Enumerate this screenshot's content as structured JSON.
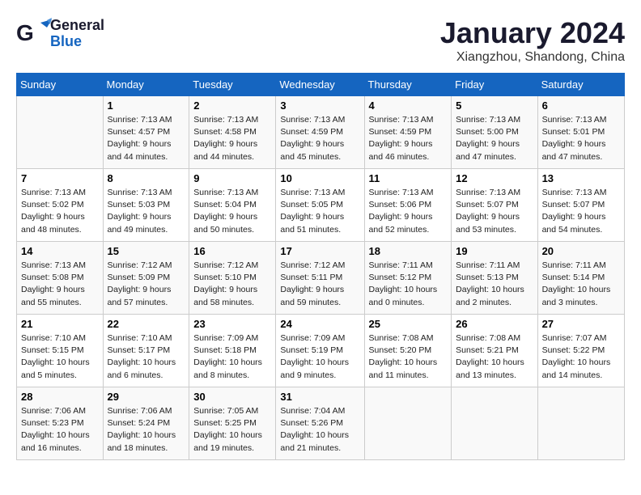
{
  "header": {
    "logo_general": "General",
    "logo_blue": "Blue",
    "month_year": "January 2024",
    "location": "Xiangzhou, Shandong, China"
  },
  "weekdays": [
    "Sunday",
    "Monday",
    "Tuesday",
    "Wednesday",
    "Thursday",
    "Friday",
    "Saturday"
  ],
  "weeks": [
    [
      {
        "day": "",
        "text": ""
      },
      {
        "day": "1",
        "text": "Sunrise: 7:13 AM\nSunset: 4:57 PM\nDaylight: 9 hours\nand 44 minutes."
      },
      {
        "day": "2",
        "text": "Sunrise: 7:13 AM\nSunset: 4:58 PM\nDaylight: 9 hours\nand 44 minutes."
      },
      {
        "day": "3",
        "text": "Sunrise: 7:13 AM\nSunset: 4:59 PM\nDaylight: 9 hours\nand 45 minutes."
      },
      {
        "day": "4",
        "text": "Sunrise: 7:13 AM\nSunset: 4:59 PM\nDaylight: 9 hours\nand 46 minutes."
      },
      {
        "day": "5",
        "text": "Sunrise: 7:13 AM\nSunset: 5:00 PM\nDaylight: 9 hours\nand 47 minutes."
      },
      {
        "day": "6",
        "text": "Sunrise: 7:13 AM\nSunset: 5:01 PM\nDaylight: 9 hours\nand 47 minutes."
      }
    ],
    [
      {
        "day": "7",
        "text": "Sunrise: 7:13 AM\nSunset: 5:02 PM\nDaylight: 9 hours\nand 48 minutes."
      },
      {
        "day": "8",
        "text": "Sunrise: 7:13 AM\nSunset: 5:03 PM\nDaylight: 9 hours\nand 49 minutes."
      },
      {
        "day": "9",
        "text": "Sunrise: 7:13 AM\nSunset: 5:04 PM\nDaylight: 9 hours\nand 50 minutes."
      },
      {
        "day": "10",
        "text": "Sunrise: 7:13 AM\nSunset: 5:05 PM\nDaylight: 9 hours\nand 51 minutes."
      },
      {
        "day": "11",
        "text": "Sunrise: 7:13 AM\nSunset: 5:06 PM\nDaylight: 9 hours\nand 52 minutes."
      },
      {
        "day": "12",
        "text": "Sunrise: 7:13 AM\nSunset: 5:07 PM\nDaylight: 9 hours\nand 53 minutes."
      },
      {
        "day": "13",
        "text": "Sunrise: 7:13 AM\nSunset: 5:07 PM\nDaylight: 9 hours\nand 54 minutes."
      }
    ],
    [
      {
        "day": "14",
        "text": "Sunrise: 7:13 AM\nSunset: 5:08 PM\nDaylight: 9 hours\nand 55 minutes."
      },
      {
        "day": "15",
        "text": "Sunrise: 7:12 AM\nSunset: 5:09 PM\nDaylight: 9 hours\nand 57 minutes."
      },
      {
        "day": "16",
        "text": "Sunrise: 7:12 AM\nSunset: 5:10 PM\nDaylight: 9 hours\nand 58 minutes."
      },
      {
        "day": "17",
        "text": "Sunrise: 7:12 AM\nSunset: 5:11 PM\nDaylight: 9 hours\nand 59 minutes."
      },
      {
        "day": "18",
        "text": "Sunrise: 7:11 AM\nSunset: 5:12 PM\nDaylight: 10 hours\nand 0 minutes."
      },
      {
        "day": "19",
        "text": "Sunrise: 7:11 AM\nSunset: 5:13 PM\nDaylight: 10 hours\nand 2 minutes."
      },
      {
        "day": "20",
        "text": "Sunrise: 7:11 AM\nSunset: 5:14 PM\nDaylight: 10 hours\nand 3 minutes."
      }
    ],
    [
      {
        "day": "21",
        "text": "Sunrise: 7:10 AM\nSunset: 5:15 PM\nDaylight: 10 hours\nand 5 minutes."
      },
      {
        "day": "22",
        "text": "Sunrise: 7:10 AM\nSunset: 5:17 PM\nDaylight: 10 hours\nand 6 minutes."
      },
      {
        "day": "23",
        "text": "Sunrise: 7:09 AM\nSunset: 5:18 PM\nDaylight: 10 hours\nand 8 minutes."
      },
      {
        "day": "24",
        "text": "Sunrise: 7:09 AM\nSunset: 5:19 PM\nDaylight: 10 hours\nand 9 minutes."
      },
      {
        "day": "25",
        "text": "Sunrise: 7:08 AM\nSunset: 5:20 PM\nDaylight: 10 hours\nand 11 minutes."
      },
      {
        "day": "26",
        "text": "Sunrise: 7:08 AM\nSunset: 5:21 PM\nDaylight: 10 hours\nand 13 minutes."
      },
      {
        "day": "27",
        "text": "Sunrise: 7:07 AM\nSunset: 5:22 PM\nDaylight: 10 hours\nand 14 minutes."
      }
    ],
    [
      {
        "day": "28",
        "text": "Sunrise: 7:06 AM\nSunset: 5:23 PM\nDaylight: 10 hours\nand 16 minutes."
      },
      {
        "day": "29",
        "text": "Sunrise: 7:06 AM\nSunset: 5:24 PM\nDaylight: 10 hours\nand 18 minutes."
      },
      {
        "day": "30",
        "text": "Sunrise: 7:05 AM\nSunset: 5:25 PM\nDaylight: 10 hours\nand 19 minutes."
      },
      {
        "day": "31",
        "text": "Sunrise: 7:04 AM\nSunset: 5:26 PM\nDaylight: 10 hours\nand 21 minutes."
      },
      {
        "day": "",
        "text": ""
      },
      {
        "day": "",
        "text": ""
      },
      {
        "day": "",
        "text": ""
      }
    ]
  ]
}
